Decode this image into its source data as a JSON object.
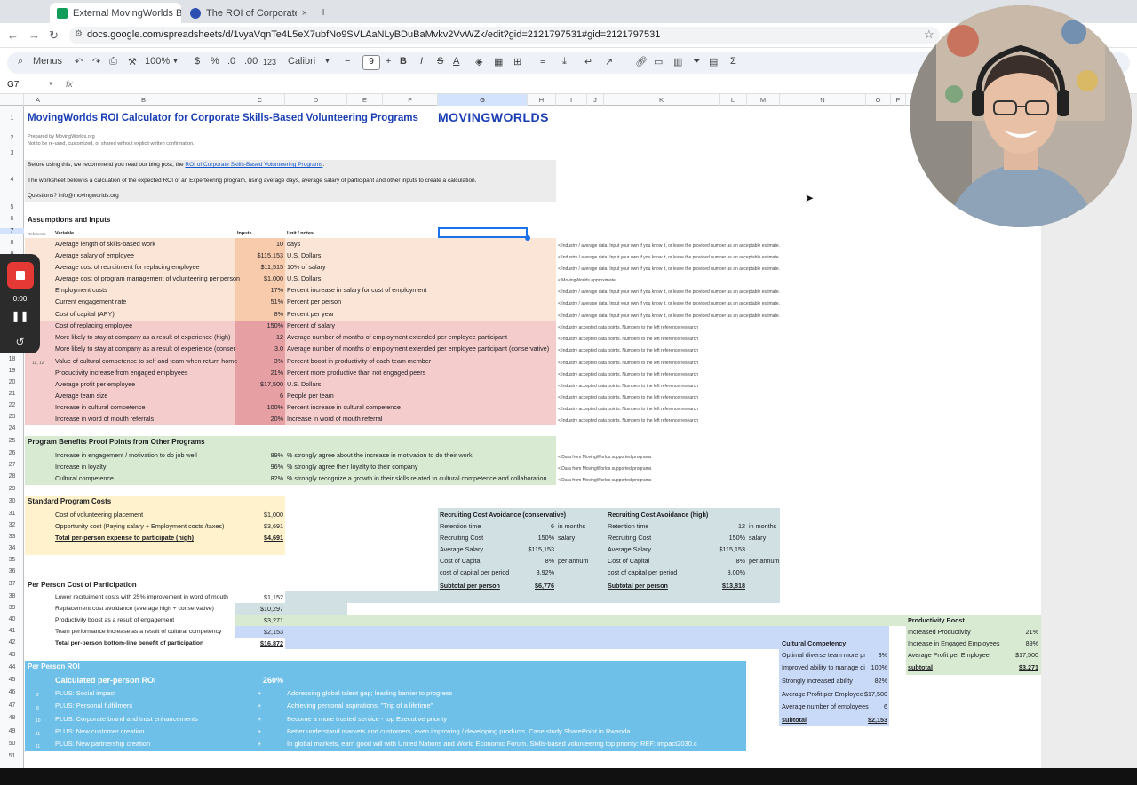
{
  "browser": {
    "tabs": [
      {
        "title": "External MovingWorlds B2B ROI",
        "close": "×"
      },
      {
        "title": "The ROI of Corporate Skills-Ba",
        "close": "×"
      }
    ],
    "new_tab": "+",
    "url": "docs.google.com/spreadsheets/d/1vyaVqnTe4L5eX7ubfNo9SVLAaNLyBDuBaMvkv2VvWZk/edit?gid=2121797531#gid=2121797531"
  },
  "toolbar": {
    "menus": "Menus",
    "zoom": "100%",
    "currency": "$",
    "percent": "%",
    "dec_minus": ".0",
    "dec_plus": ".00",
    "number_format": "123",
    "font": "Calibri",
    "font_size": "9",
    "bold": "B",
    "italic": "I",
    "strike": "S",
    "sum": "Σ"
  },
  "formula_bar": {
    "cell": "G7",
    "fx": "fx"
  },
  "columns": [
    "A",
    "B",
    "C",
    "D",
    "E",
    "F",
    "G",
    "H",
    "I",
    "J",
    "K",
    "L",
    "M",
    "N",
    "O",
    "P"
  ],
  "rows": [
    "1",
    "2",
    "3",
    "4",
    "5",
    "6",
    "7",
    "8",
    "9",
    "10",
    "11",
    "12",
    "13",
    "14",
    "15",
    "16",
    "17",
    "18",
    "19",
    "20",
    "21",
    "22",
    "23",
    "24",
    "25",
    "26",
    "27",
    "28",
    "29",
    "30",
    "31",
    "32",
    "33",
    "34",
    "35",
    "36",
    "37",
    "38",
    "39",
    "40",
    "41",
    "42",
    "43",
    "44",
    "45",
    "46",
    "47",
    "48",
    "49",
    "50",
    "51"
  ],
  "sheet": {
    "title": "MovingWorlds ROI Calculator for Corporate Skills-Based Volunteering Programs",
    "logo": "MOVINGWORLDS",
    "prepared": "Prepared by MovingWorlds.org",
    "not_reused": "Not to be re-used, customized, or shared without explicit written confirmation.",
    "intro_pre": "Before using this, we recommend you read our blog post, the ",
    "intro_link": "ROI of Corporate Skills-Based Volunteering Programs",
    "intro_post": ".",
    "worksheet_desc": "The worksheet below is a calcuation of the expected ROI of an Experteering program, using average days, average salary of participant and other inputs to create a calculation.",
    "questions": "Questions? info@movingworlds.org",
    "assumptions_title": "Assumptions and Inputs",
    "hdr_reference": "Reference",
    "hdr_variable": "Variable",
    "hdr_inputs": "Inputs",
    "hdr_unit": "Unit / notes",
    "assumptions": [
      {
        "var": "Average length of skills-based work",
        "val": "10",
        "unit": "days",
        "note": "< Industry / average data. Input your own if you know it, or leave the provided number as an acceptable estimate."
      },
      {
        "var": "Average salary of employee",
        "val": "$115,153",
        "unit": "U.S. Dollars",
        "note": "< Industry / average data. Input your own if you know it, or leave the provided number as an acceptable estimate."
      },
      {
        "var": "Average cost of recruitment for replacing employee",
        "val": "$11,515",
        "unit": "10% of salary",
        "note": "< Industry / average data. Input your own if you know it, or leave the provided number as an acceptable estimate."
      },
      {
        "var": "Average cost of program management of volunteering per person",
        "val": "$1,000",
        "unit": "U.S. Dollars",
        "note": "< MovingWorlds approximate"
      },
      {
        "var": "Employment costs",
        "val": "17%",
        "unit": "Percent increase in salary for cost of employment",
        "note": "< Industry / average data. Input your own if you know it, or leave the provided number as an acceptable estimate."
      },
      {
        "var": "Current engagement rate",
        "val": "51%",
        "unit": "Percent per person",
        "note": "< Industry / average data. Input your own if you know it, or leave the provided number as an acceptable estimate."
      },
      {
        "var": "Cost of capital (APY)",
        "val": "8%",
        "unit": "Percent per year",
        "note": "< Industry / average data. Input your own if you know it, or leave the provided number as an acceptable estimate."
      }
    ],
    "research": [
      {
        "var": "Cost of replacing employee",
        "val": "150%",
        "unit": "Percent of salary",
        "note": "< Industry accepted data points. Numbers to the left reference research"
      },
      {
        "var": "More likely to stay at company as a result of experience (high)",
        "val": "12",
        "unit": "Average number of months of employment extended per employee participant",
        "note": "< Industry accepted data points. Numbers to the left reference research"
      },
      {
        "var": "More likely to stay at company as a result of experience (conservat",
        "val": "3.0",
        "unit": "Average number of months of employment extended per employee participant (conservative)",
        "note": "< Industry accepted data points. Numbers to the left reference research"
      },
      {
        "var": "Value of cultural competence to self and team when return home",
        "val": "3%",
        "unit": "Percent boost in productivity of each team member",
        "note": "< Industry accepted data points. Numbers to the left reference research"
      },
      {
        "var": "Productivity increase from engaged employees",
        "val": "21%",
        "unit": "Percent more productive than not engaged peers",
        "note": "< Industry accepted data points. Numbers to the left reference research"
      },
      {
        "var": "Average profit per employee",
        "val": "$17,500",
        "unit": "U.S. Dollars",
        "note": "< Industry accepted data points. Numbers to the left reference research"
      },
      {
        "var": "Average team size",
        "val": "6",
        "unit": "People per team",
        "note": "< Industry accepted data points. Numbers to the left reference research"
      },
      {
        "var": "Increase in cultural competence",
        "val": "100%",
        "unit": "Percent increase in cultural competence",
        "note": "< Industry accepted data points. Numbers to the left reference research"
      },
      {
        "var": "Increase in word of mouth referrals",
        "val": "20%",
        "unit": "Increase in word of mouth referral",
        "note": "< Industry accepted data points. Numbers to the left reference research"
      }
    ],
    "research_refs": [
      "",
      "",
      "",
      "11, 12",
      "",
      "",
      "",
      "",
      ""
    ],
    "proof_title": "Program Benefits Proof Points from Other Programs",
    "proof": [
      {
        "var": "Increase in engagement / motivation to do job well",
        "val": "89%",
        "unit": "% strongly agree about the increase in motivation to do their work",
        "note": "< Data from MovingWorlds supported programs"
      },
      {
        "var": "Increase in loyalty",
        "val": "96%",
        "unit": "% strongly agree their loyalty to their company",
        "note": "< Data from MovingWorlds supported programs"
      },
      {
        "var": "Cultural competence",
        "val": "82%",
        "unit": "% strongly recognize a growth in their skills related to cultural competence and collaboration",
        "note": "< Data from MovingWorlds supported programs"
      }
    ],
    "costs_title": "Standard Program Costs",
    "costs": [
      {
        "var": "Cost of volunteering placement",
        "val": "$1,000"
      },
      {
        "var": "Opportunity cost (Paying salary + Employment costs /taxes)",
        "val": "$3,691"
      },
      {
        "var": "Total per-person expense to participate (high)",
        "val": "$4,691"
      }
    ],
    "rca_cons": {
      "title": "Recruiting Cost Avoidance (conservative)",
      "rows": [
        {
          "k": "Retention time",
          "v": "6",
          "u": "in months"
        },
        {
          "k": "Recruiting Cost",
          "v": "150%",
          "u": "salary"
        },
        {
          "k": "Average Salary",
          "v": "$115,153",
          "u": ""
        },
        {
          "k": "Cost of Capital",
          "v": "8%",
          "u": "per annum"
        },
        {
          "k": "cost of capital per period",
          "v": "3.92%",
          "u": ""
        }
      ],
      "subtotal_k": "Subtotal per person",
      "subtotal_v": "$6,776"
    },
    "rca_high": {
      "title": "Recruiting Cost Avoidance (high)",
      "rows": [
        {
          "k": "Retention time",
          "v": "12",
          "u": "in months"
        },
        {
          "k": "Recruiting Cost",
          "v": "150%",
          "u": "salary"
        },
        {
          "k": "Average Salary",
          "v": "$115,153",
          "u": ""
        },
        {
          "k": "Cost of Capital",
          "v": "8%",
          "u": "per annum"
        },
        {
          "k": "cost of capital per period",
          "v": "8.00%",
          "u": ""
        }
      ],
      "subtotal_k": "Subtotal per person",
      "subtotal_v": "$13,818"
    },
    "ppc_title": "Per Person Cost of Participation",
    "ppc": [
      {
        "var": "Lower recrtuiment costs with 25% improvement in word of mouth",
        "val": "$1,152"
      },
      {
        "var": "Replacement cost avoidance (average high + conservative)",
        "val": "$10,297"
      },
      {
        "var": "Productivity boost as a result of engagement",
        "val": "$3,271"
      },
      {
        "var": "Team performance increase as a result of cultural competency",
        "val": "$2,153"
      },
      {
        "var": "Total per-person bottom-line benefit of participation",
        "val": "$16,872"
      }
    ],
    "prod_boost": {
      "title": "Productivity Boost",
      "rows": [
        {
          "k": "Increased Productivity",
          "v": "21%"
        },
        {
          "k": "Increase in Engaged Employees",
          "v": "89%"
        },
        {
          "k": "Average Profit per Employee",
          "v": "$17,500"
        }
      ],
      "subtotal_k": "subtotal",
      "subtotal_v": "$3,271"
    },
    "cult_comp": {
      "title": "Cultural Competency",
      "rows": [
        {
          "k": "Optimal diverse team more prc",
          "v": "3%"
        },
        {
          "k": "Improved ability to manage div",
          "v": "100%"
        },
        {
          "k": "Strongly increased ability",
          "v": "82%"
        },
        {
          "k": "Average Profit per Employee",
          "v": "$17,500"
        },
        {
          "k": "Average number of employees",
          "v": "6"
        }
      ],
      "subtotal_k": "subtotal",
      "subtotal_v": "$2,153"
    },
    "roi_title": "Per Person ROI",
    "roi_label": "Calculated per-person ROI",
    "roi_value": "260%",
    "plus": [
      {
        "ref": "2",
        "label": "PLUS: Social impact",
        "sign": "+",
        "desc": "Addressing global talent gap; leading barrier to progress"
      },
      {
        "ref": "8",
        "label": "PLUS: Personal fulfillment",
        "sign": "+",
        "desc": "Achieving personal aspirations; \"Trip of a lifetime\""
      },
      {
        "ref": "10",
        "label": "PLUS: Corporate brand and trust enhancements",
        "sign": "+",
        "desc": "Become a more trusted service - top Executive priority"
      },
      {
        "ref": "11",
        "label": "PLUS: New customer creation",
        "sign": "+",
        "desc": "Better understand markets and customers, even improving / developing products. Case study SharePoint in Rwanda"
      },
      {
        "ref": "11",
        "label": "PLUS: New partnership creation",
        "sign": "+",
        "desc": "In global markets, earn good will with United Nations and World Economic Forum. Skills-based volunteering top priority: REF: impact2030.c"
      }
    ]
  },
  "recorder": {
    "time": "0:00"
  },
  "colors": {
    "peach": "#fbe5d6",
    "peach_input": "#f8cbad",
    "pink": "#f4cccc",
    "pink_input": "#e6a0a4",
    "green": "#d9ead3",
    "yellow": "#fff2cc",
    "teal": "#d0e0e3",
    "lavender": "#c9daf8",
    "blue": "#6fc0e8",
    "title_blue": "#1a3fb5"
  }
}
